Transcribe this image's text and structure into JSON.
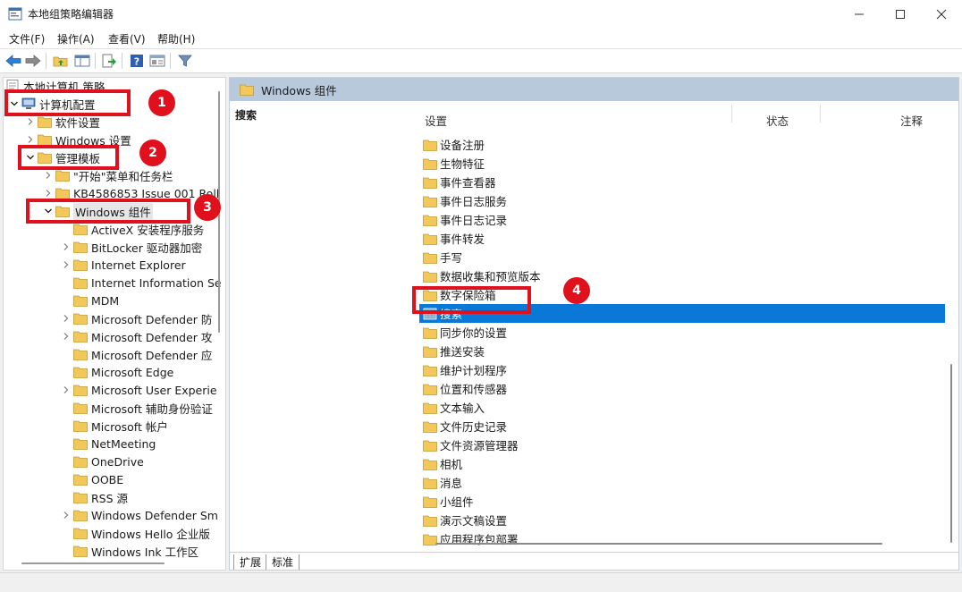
{
  "window": {
    "title": "本地组策略编辑器"
  },
  "menu": {
    "items": [
      "文件(F)",
      "操作(A)",
      "查看(V)",
      "帮助(H)"
    ]
  },
  "tree": {
    "items": [
      {
        "label": "本地计算机 策略",
        "icon": "policy-doc-icon",
        "expander": "none"
      },
      {
        "label": "计算机配置",
        "icon": "computer-icon",
        "expander": "expanded"
      },
      {
        "label": "软件设置",
        "icon": "folder-icon",
        "expander": "collapsed"
      },
      {
        "label": "Windows 设置",
        "icon": "folder-icon",
        "expander": "collapsed"
      },
      {
        "label": "管理模板",
        "icon": "folder-icon",
        "expander": "expanded"
      },
      {
        "label": "\"开始\"菜单和任务栏",
        "icon": "folder-icon",
        "expander": "collapsed"
      },
      {
        "label": "KB4586853 Issue 001 Roll",
        "icon": "folder-icon",
        "expander": "collapsed"
      },
      {
        "label": "Windows 组件",
        "icon": "folder-icon",
        "expander": "expanded"
      },
      {
        "label": "ActiveX 安装程序服务",
        "icon": "folder-icon",
        "expander": "none"
      },
      {
        "label": "BitLocker 驱动器加密",
        "icon": "folder-icon",
        "expander": "collapsed"
      },
      {
        "label": "Internet Explorer",
        "icon": "folder-icon",
        "expander": "collapsed"
      },
      {
        "label": "Internet Information Se",
        "icon": "folder-icon",
        "expander": "none"
      },
      {
        "label": "MDM",
        "icon": "folder-icon",
        "expander": "none"
      },
      {
        "label": "Microsoft Defender 防",
        "icon": "folder-icon",
        "expander": "collapsed"
      },
      {
        "label": "Microsoft Defender 攻",
        "icon": "folder-icon",
        "expander": "collapsed"
      },
      {
        "label": "Microsoft Defender 应",
        "icon": "folder-icon",
        "expander": "none"
      },
      {
        "label": "Microsoft Edge",
        "icon": "folder-icon",
        "expander": "none"
      },
      {
        "label": "Microsoft User Experie",
        "icon": "folder-icon",
        "expander": "collapsed"
      },
      {
        "label": "Microsoft 辅助身份验证",
        "icon": "folder-icon",
        "expander": "none"
      },
      {
        "label": "Microsoft 帐户",
        "icon": "folder-icon",
        "expander": "none"
      },
      {
        "label": "NetMeeting",
        "icon": "folder-icon",
        "expander": "none"
      },
      {
        "label": "OneDrive",
        "icon": "folder-icon",
        "expander": "none"
      },
      {
        "label": "OOBE",
        "icon": "folder-icon",
        "expander": "none"
      },
      {
        "label": "RSS 源",
        "icon": "folder-icon",
        "expander": "none"
      },
      {
        "label": "Windows Defender Sm",
        "icon": "folder-icon",
        "expander": "collapsed"
      },
      {
        "label": "Windows Hello 企业版",
        "icon": "folder-icon",
        "expander": "none"
      },
      {
        "label": "Windows Ink 工作区",
        "icon": "folder-icon",
        "expander": "none"
      }
    ]
  },
  "right": {
    "header_title": "Windows 组件",
    "left_title": "搜索",
    "columns": [
      "设置",
      "状态",
      "注释"
    ],
    "rows": [
      "设备注册",
      "生物特征",
      "事件查看器",
      "事件日志服务",
      "事件日志记录",
      "事件转发",
      "手写",
      "数据收集和预览版本",
      "数字保险箱",
      "搜索",
      "同步你的设置",
      "推送安装",
      "维护计划程序",
      "位置和传感器",
      "文本输入",
      "文件历史记录",
      "文件资源管理器",
      "相机",
      "消息",
      "小组件",
      "演示文稿设置",
      "应用程序包部署"
    ],
    "selected_index": 9
  },
  "tabs": [
    "扩展",
    "标准"
  ],
  "callouts": [
    "1",
    "2",
    "3",
    "4"
  ],
  "colors": {
    "highlight": "#e0101c",
    "selection": "#0a78d7",
    "header": "#b9c9dc",
    "folder": "#f2c85b"
  }
}
